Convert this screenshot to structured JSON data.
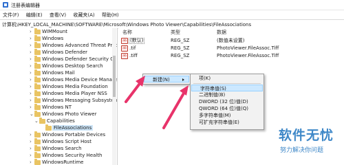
{
  "window": {
    "title": "注册表编辑器"
  },
  "menubar": [
    "文件(F)",
    "编辑(E)",
    "查看(V)",
    "收藏夹(A)",
    "帮助(H)"
  ],
  "address": "计算机\\HKEY_LOCAL_MACHINE\\SOFTWARE\\Microsoft\\Windows Photo Viewer\\Capabilities\\FileAssociations",
  "tree": [
    "WIMMount",
    "Windows",
    "Windows Advanced Threat Prot",
    "Windows Defender",
    "Windows Defender Security Cen",
    "Windows Desktop Search",
    "Windows Mail",
    "Windows Media Device Manage",
    "Windows Media Foundation",
    "Windows Media Player NSS",
    "Windows Messaging Subsystem",
    "Windows NT",
    "Windows Photo Viewer",
    "Capabilities",
    "FileAssociations",
    "Windows Portable Devices",
    "Windows Script Host",
    "Windows Search",
    "Windows Security Health",
    "WindowsRuntime"
  ],
  "list": {
    "headers": {
      "name": "名称",
      "type": "类型",
      "data": "数据"
    },
    "rows": [
      {
        "name": "(默认)",
        "type": "REG_SZ",
        "data": "(数值未设置)"
      },
      {
        "name": ".tif",
        "type": "REG_SZ",
        "data": "PhotoViewer.FileAssoc.Tiff"
      },
      {
        "name": ".tiff",
        "type": "REG_SZ",
        "data": "PhotoViewer.FileAssoc.Tiff"
      }
    ]
  },
  "context_menu": {
    "new_label": "新建(N)"
  },
  "submenu": {
    "items": [
      "项(K)",
      "字符串值(S)",
      "二进制值(B)",
      "DWORD (32 位)值(D)",
      "QWORD (64 位)值(Q)",
      "多字符串值(M)",
      "可扩充字符串值(E)"
    ]
  },
  "watermark": {
    "title": "软件无忧",
    "subtitle": "努力解决你问题"
  },
  "colors": {
    "arrow": "#e8336a",
    "highlight": "#cce8ff",
    "folder": "#e9c463",
    "watermark": "#3f88c8"
  }
}
